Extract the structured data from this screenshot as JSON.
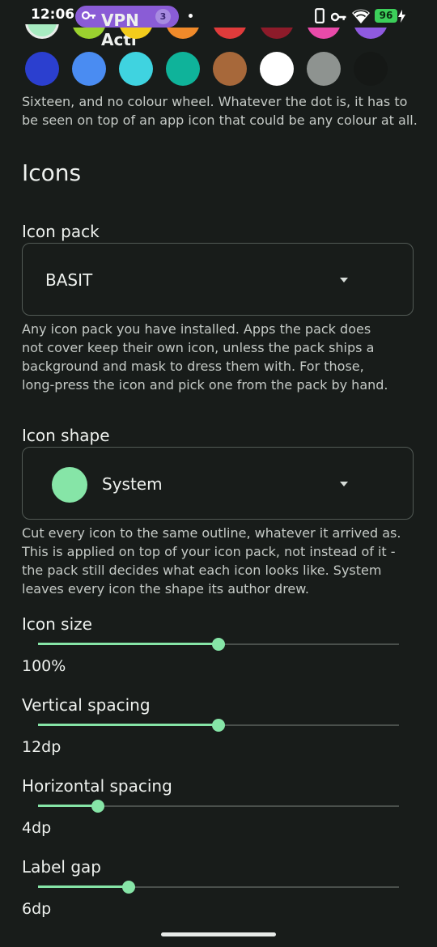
{
  "status": {
    "time": "12:06",
    "vpn_label": "VPN Acti",
    "vpn_count": "3",
    "battery": "96"
  },
  "colours": {
    "partial_row": [
      "#a7ebc1",
      "#9bd12f",
      "#f3cc1c",
      "#f08a2a",
      "#e03b3b",
      "#8d1b2a",
      "#e84aa9",
      "#8f5ae0"
    ],
    "full_row": [
      "#2b3fcf",
      "#4a8cf2",
      "#3fd3e0",
      "#0fb39a",
      "#a7683a",
      "#ffffff",
      "#8e9390",
      "#151816"
    ],
    "help": "Sixteen, and no colour wheel. Whatever the dot is, it has to be seen on top of an app icon that could be any colour at all."
  },
  "icons": {
    "title": "Icons",
    "pack": {
      "label": "Icon pack",
      "value": "BASIT",
      "help": "Any icon pack you have installed. Apps the pack does not cover keep their own icon, unless the pack ships a background and mask to dress them with. For those, long-press the icon and pick one from the pack by hand."
    },
    "shape": {
      "label": "Icon shape",
      "value": "System",
      "help": "Cut every icon to the same outline, whatever it arrived as. This is applied on top of your icon pack, not instead of it - the pack still decides what each icon looks like. System leaves every icon the shape its author drew."
    },
    "sliders": [
      {
        "label": "Icon size",
        "value": "100%",
        "fraction": 0.5
      },
      {
        "label": "Vertical spacing",
        "value": "12dp",
        "fraction": 0.5
      },
      {
        "label": "Horizontal spacing",
        "value": "4dp",
        "fraction": 0.167
      },
      {
        "label": "Label gap",
        "value": "6dp",
        "fraction": 0.25
      }
    ]
  },
  "accent": "#86e5a7"
}
